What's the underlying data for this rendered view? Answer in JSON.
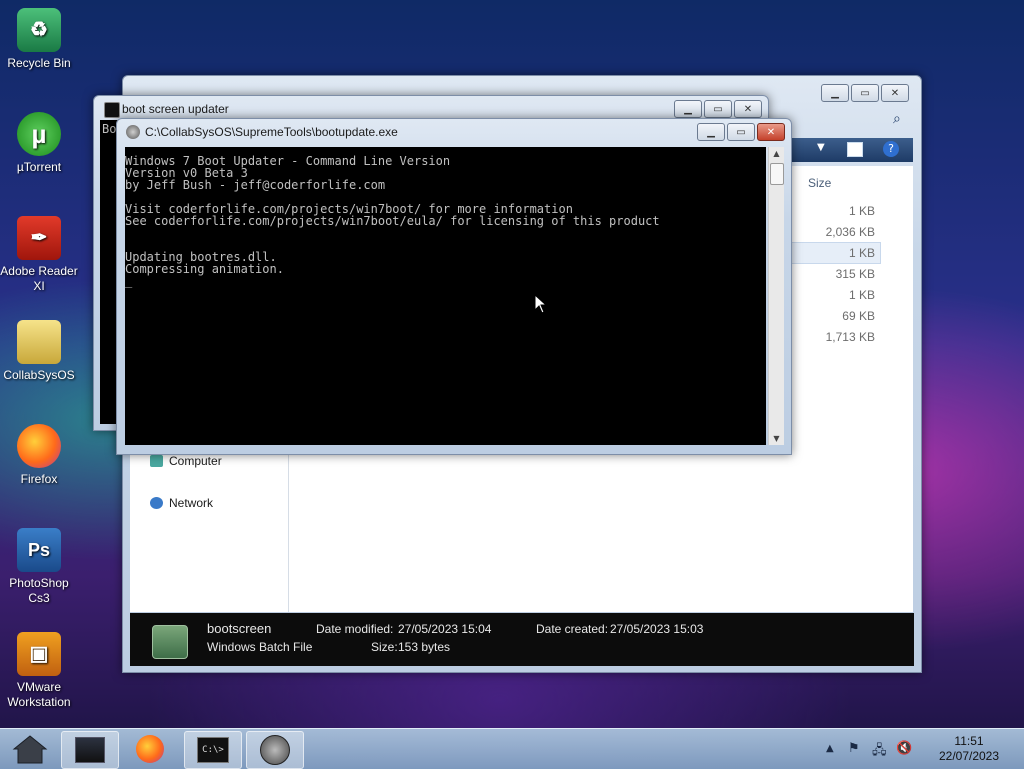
{
  "desktop": {
    "icons": [
      {
        "label": "Recycle Bin",
        "icon": "recycle-bin-icon"
      },
      {
        "label": "µTorrent",
        "icon": "utorrent-icon"
      },
      {
        "label": "Adobe Reader XI",
        "icon": "adobe-reader-icon"
      },
      {
        "label": "CollabSysOS",
        "icon": "folder-icon"
      },
      {
        "label": "Firefox",
        "icon": "firefox-icon"
      },
      {
        "label": "PhotoShop Cs3",
        "icon": "photoshop-icon"
      },
      {
        "label": "VMware Workstation",
        "icon": "vmware-icon"
      }
    ]
  },
  "explorer": {
    "size_header": "Size",
    "sizes": [
      "1 KB",
      "2,036 KB",
      "1 KB",
      "315 KB",
      "1 KB",
      "69 KB",
      "1,713 KB"
    ],
    "nav": {
      "computer": "Computer",
      "network": "Network"
    },
    "details": {
      "filename": "bootscreen",
      "filetype": "Windows Batch File",
      "date_modified_label": "Date modified:",
      "date_modified": "27/05/2023 15:04",
      "date_created_label": "Date created:",
      "date_created": "27/05/2023 15:03",
      "size_label": "Size:",
      "size": "153 bytes"
    }
  },
  "bg_console": {
    "title": "boot screen updater",
    "peek_text": "Bo"
  },
  "console": {
    "title": "C:\\CollabSysOS\\SupremeTools\\bootupdate.exe",
    "lines": [
      "Windows 7 Boot Updater - Command Line Version",
      "Version v0 Beta 3",
      "by Jeff Bush - jeff@coderforlife.com",
      "",
      "Visit coderforlife.com/projects/win7boot/ for more information",
      "See coderforlife.com/projects/win7boot/eula/ for licensing of this product",
      "",
      "",
      "Updating bootres.dll.",
      "Compressing animation.",
      "_"
    ]
  },
  "taskbar": {
    "items": [
      "home-icon",
      "file-explorer-icon",
      "firefox-icon",
      "command-prompt-icon",
      "boot-updater-icon"
    ],
    "cmd_glyph": "C:\\>",
    "clock_time": "11:51",
    "clock_date": "22/07/2023"
  },
  "colors": {
    "console_bg": "#000000",
    "console_fg": "#c0c0c0",
    "taskbar": "#9fb9d6"
  }
}
